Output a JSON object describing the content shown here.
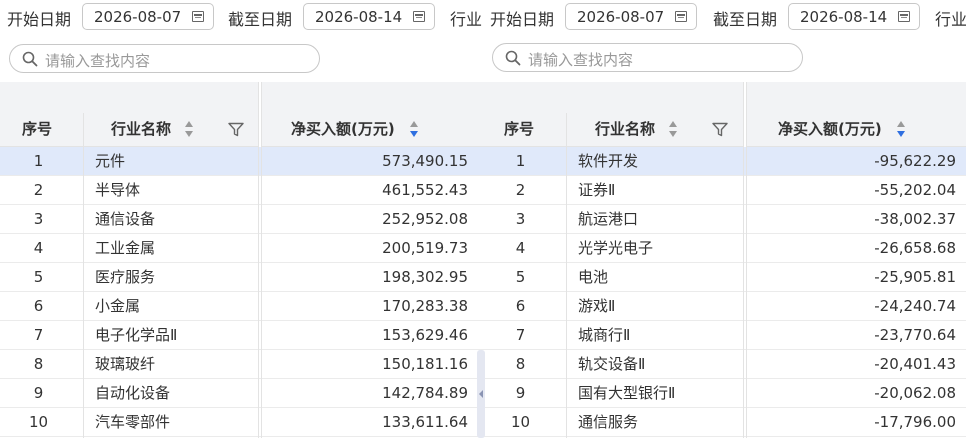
{
  "left": {
    "filters": {
      "start_label": "开始日期",
      "start_date": "2026-08-07",
      "end_label": "截至日期",
      "end_date": "2026-08-14",
      "industry_label": "行业"
    },
    "search": {
      "placeholder": "请输入查找内容"
    },
    "columns": {
      "idx": "序号",
      "name": "行业名称",
      "value": "净买入额(万元)"
    },
    "rows": [
      {
        "idx": "1",
        "name": "元件",
        "value": "573,490.15"
      },
      {
        "idx": "2",
        "name": "半导体",
        "value": "461,552.43"
      },
      {
        "idx": "3",
        "name": "通信设备",
        "value": "252,952.08"
      },
      {
        "idx": "4",
        "name": "工业金属",
        "value": "200,519.73"
      },
      {
        "idx": "5",
        "name": "医疗服务",
        "value": "198,302.95"
      },
      {
        "idx": "6",
        "name": "小金属",
        "value": "170,283.38"
      },
      {
        "idx": "7",
        "name": "电子化学品Ⅱ",
        "value": "153,629.46"
      },
      {
        "idx": "8",
        "name": "玻璃玻纤",
        "value": "150,181.16"
      },
      {
        "idx": "9",
        "name": "自动化设备",
        "value": "142,784.89"
      },
      {
        "idx": "10",
        "name": "汽车零部件",
        "value": "133,611.64"
      }
    ]
  },
  "right": {
    "filters": {
      "start_label": "开始日期",
      "start_date": "2026-08-07",
      "end_label": "截至日期",
      "end_date": "2026-08-14",
      "industry_label": "行业"
    },
    "search": {
      "placeholder": "请输入查找内容"
    },
    "columns": {
      "idx": "序号",
      "name": "行业名称",
      "value": "净买入额(万元)"
    },
    "rows": [
      {
        "idx": "1",
        "name": "软件开发",
        "value": "-95,622.29"
      },
      {
        "idx": "2",
        "name": "证券Ⅱ",
        "value": "-55,202.04"
      },
      {
        "idx": "3",
        "name": "航运港口",
        "value": "-38,002.37"
      },
      {
        "idx": "4",
        "name": "光学光电子",
        "value": "-26,658.68"
      },
      {
        "idx": "5",
        "name": "电池",
        "value": "-25,905.81"
      },
      {
        "idx": "6",
        "name": "游戏Ⅱ",
        "value": "-24,240.74"
      },
      {
        "idx": "7",
        "name": "城商行Ⅱ",
        "value": "-23,770.64"
      },
      {
        "idx": "8",
        "name": "轨交设备Ⅱ",
        "value": "-20,401.43"
      },
      {
        "idx": "9",
        "name": "国有大型银行Ⅱ",
        "value": "-20,062.08"
      },
      {
        "idx": "10",
        "name": "通信服务",
        "value": "-17,796.00"
      }
    ]
  }
}
